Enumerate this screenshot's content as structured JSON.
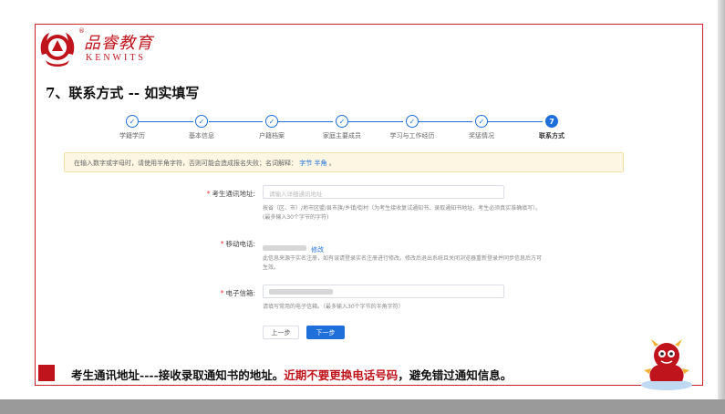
{
  "logo": {
    "cn_text": "品睿教育",
    "en_text": "KENWITS",
    "reg_mark": "®",
    "brand_color": "#c0141c"
  },
  "page_title": "7、联系方式 -- 如实填写",
  "steps": [
    {
      "label": "学籍学历",
      "marker": "✓",
      "done": true
    },
    {
      "label": "基本信息",
      "marker": "✓",
      "done": true
    },
    {
      "label": "户籍档案",
      "marker": "✓",
      "done": true
    },
    {
      "label": "家庭主要成员",
      "marker": "✓",
      "done": true
    },
    {
      "label": "学习与工作经历",
      "marker": "✓",
      "done": true
    },
    {
      "label": "奖惩情况",
      "marker": "✓",
      "done": true
    },
    {
      "label": "联系方式",
      "marker": "7",
      "active": true
    }
  ],
  "notice": {
    "text": "在输入数字或字母时，请使用半角字符，否则可能会造成报名失败；名词解释：",
    "link_text": "字节 半角",
    "suffix": "。"
  },
  "form": {
    "address": {
      "label": "考生通讯地址:",
      "required_mark": "*",
      "placeholder": "请输入详细通讯地址",
      "hint1": "按省（区、市）/地市区盟/县市旗/乡镇/街村（为考生接收复试通知书、录取通知书地址，考生必须真实准确填写）。",
      "hint2": "(最多输入30个字节的字符)"
    },
    "phone": {
      "label": "移动电话:",
      "required_mark": "*",
      "edit_text": "修改",
      "hint1": "此信息来源于实名注册，如有误请登录实名注册进行修改。修改后退出系统且关闭浏览器重新登录并同步信息后方可",
      "hint2": "生效。"
    },
    "email": {
      "label": "电子信箱:",
      "required_mark": "*",
      "hint": "请填写常用的电子信箱。（最多输入30个字节的半角字符）"
    }
  },
  "buttons": {
    "prev": "上一步",
    "next": "下一步"
  },
  "caption": {
    "part1": "考生通讯地址----接收录取通知书的地址。",
    "part2": "近期不要更换电话号码",
    "part3": "，避免错过通知信息。"
  },
  "colors": {
    "accent": "#1e6fd9",
    "brand_red": "#c0141c",
    "notice_bg": "#fdf6e3"
  }
}
